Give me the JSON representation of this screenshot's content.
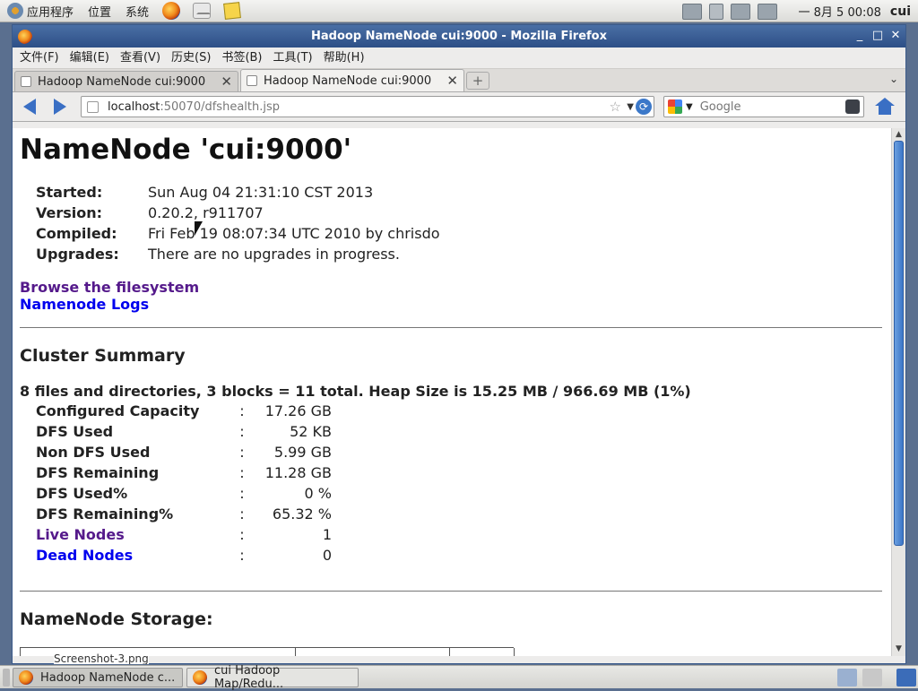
{
  "top_panel": {
    "menus": [
      "应用程序",
      "位置",
      "系统"
    ],
    "clock": "一 8月  5 00:08",
    "username": "cui"
  },
  "window": {
    "title": "Hadoop NameNode cui:9000 - Mozilla Firefox",
    "menubar": [
      "文件(F)",
      "编辑(E)",
      "查看(V)",
      "历史(S)",
      "书签(B)",
      "工具(T)",
      "帮助(H)"
    ],
    "tabs": [
      {
        "label": "Hadoop NameNode cui:9000",
        "close": "✕"
      },
      {
        "label": "Hadoop NameNode cui:9000",
        "close": "✕"
      }
    ],
    "url_host": "localhost",
    "url_path": ":50070/dfshealth.jsp",
    "search_placeholder": "Google"
  },
  "page": {
    "heading": "NameNode 'cui:9000'",
    "info": [
      {
        "key": "Started:",
        "value": "Sun Aug 04 21:31:10 CST 2013"
      },
      {
        "key": "Version:",
        "value": "0.20.2, r911707"
      },
      {
        "key": "Compiled:",
        "value": "Fri Feb 19 08:07:34 UTC 2010 by chrisdo"
      },
      {
        "key": "Upgrades:",
        "value": "There are no upgrades in progress."
      }
    ],
    "links": [
      "Browse the filesystem",
      "Namenode Logs"
    ],
    "cluster_summary_title": "Cluster Summary",
    "summary_line": "8 files and directories, 3 blocks = 11 total. Heap Size is 15.25 MB / 966.69 MB (1%)",
    "cluster": [
      {
        "key": "Configured Capacity",
        "sep": ":",
        "value": "17.26 GB"
      },
      {
        "key": "DFS Used",
        "sep": ":",
        "value": "52 KB"
      },
      {
        "key": "Non DFS Used",
        "sep": ":",
        "value": "5.99 GB"
      },
      {
        "key": "DFS Remaining",
        "sep": ":",
        "value": "11.28 GB"
      },
      {
        "key": "DFS Used%",
        "sep": ":",
        "value": "0 %"
      },
      {
        "key": "DFS Remaining%",
        "sep": ":",
        "value": "65.32 %"
      },
      {
        "key": "Live Nodes",
        "sep": ":",
        "value": "1"
      },
      {
        "key": "Dead Nodes",
        "sep": ":",
        "value": "0"
      }
    ],
    "storage_title": "NameNode Storage:"
  },
  "taskbar": {
    "tasks": [
      "Hadoop NameNode c...",
      "cui Hadoop Map/Redu..."
    ],
    "screenshot_tip": "Screenshot-3.png"
  }
}
